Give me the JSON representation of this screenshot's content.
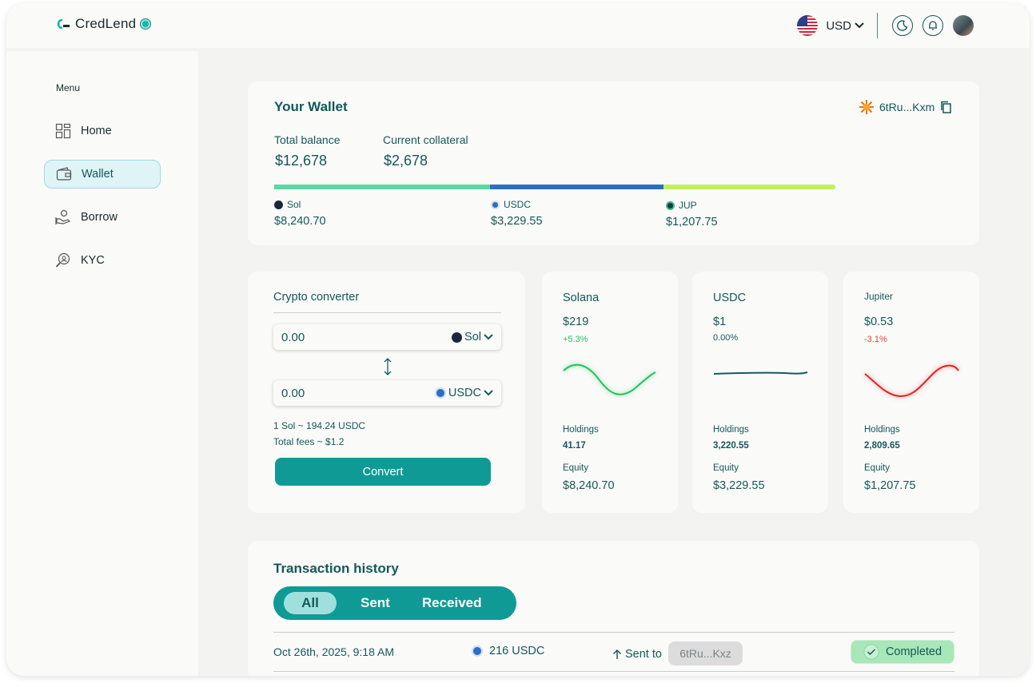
{
  "app": {
    "name": "CredLend"
  },
  "header": {
    "currency": "USD"
  },
  "sidebar": {
    "menu_title": "Menu",
    "items": [
      {
        "label": "Home",
        "icon": "grid-icon"
      },
      {
        "label": "Wallet",
        "icon": "wallet-icon",
        "active": true
      },
      {
        "label": "Borrow",
        "icon": "borrow-icon"
      },
      {
        "label": "KYC",
        "icon": "kyc-icon"
      }
    ]
  },
  "wallet": {
    "title": "Your Wallet",
    "address": "6tRu...Kxm",
    "total_balance_label": "Total balance",
    "total_balance": "$12,678",
    "collateral_label": "Current collateral",
    "collateral": "$2,678",
    "allocations": [
      {
        "name": "Sol",
        "value": "$8,240.70",
        "color": "#55dba3",
        "share": 0.385
      },
      {
        "name": "USDC",
        "value": "$3,229.55",
        "color": "#2a6fc4",
        "share": 0.309
      },
      {
        "name": "JUP",
        "value": "$1,207.75",
        "color": "#c3ef5a",
        "share": 0.306
      }
    ]
  },
  "converter": {
    "title": "Crypto converter",
    "from_value": "0.00",
    "from_token": "Sol",
    "to_value": "0.00",
    "to_token": "USDC",
    "rate": "1 Sol ~ 194.24 USDC",
    "fees": "Total fees ~ $1.2",
    "convert_label": "Convert"
  },
  "tokens": [
    {
      "name": "Solana",
      "price": "$219",
      "change": "+5.3%",
      "change_color": "#2fba6a",
      "holdings_label": "Holdings",
      "holdings": "41.17",
      "equity_label": "Equity",
      "equity": "$8,240.70",
      "trend_color": "#22c55e"
    },
    {
      "name": "USDC",
      "price": "$1",
      "change": "0.00%",
      "change_color": "#14585a",
      "holdings_label": "Holdings",
      "holdings": "3,220.55",
      "equity_label": "Equity",
      "equity": "$3,229.55",
      "trend_color": "#0f5e5e"
    },
    {
      "name": "Jupiter",
      "price": "$0.53",
      "change": "-3.1%",
      "change_color": "#e0473d",
      "holdings_label": "Holdings",
      "holdings": "2,809.65",
      "equity_label": "Equity",
      "equity": "$1,207.75",
      "trend_color": "#dc2626"
    }
  ],
  "transactions": {
    "title": "Transaction history",
    "tabs": [
      "All",
      "Sent",
      "Received"
    ],
    "rows": [
      {
        "date": "Oct 26th, 2025, 9:18 AM",
        "amount": "216 USDC",
        "direction": "Sent to",
        "address": "6tRu...Kxz",
        "status": "Completed"
      }
    ]
  }
}
